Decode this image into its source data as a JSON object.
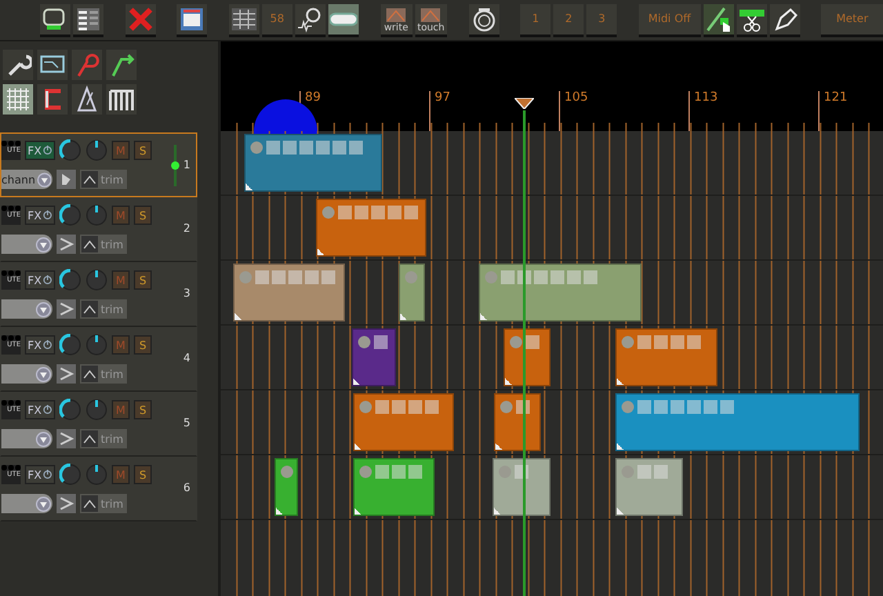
{
  "toolbar": {
    "snap_value": "58",
    "automation": [
      "write",
      "touch"
    ],
    "screensets": [
      "1",
      "2",
      "3"
    ],
    "midi": "Midi Off",
    "meter": "Meter"
  },
  "ruler": {
    "bars": [
      "89",
      "97",
      "105",
      "113",
      "121"
    ]
  },
  "tracks": [
    {
      "number": "1",
      "selected": true,
      "mute_label": "UTE",
      "fx_label": "FX",
      "fx_on": true,
      "mute": "M",
      "solo": "S",
      "input": "chann",
      "trim": "trim",
      "clips": [
        {
          "color": "#2a7a9a"
        }
      ]
    },
    {
      "number": "2",
      "selected": false,
      "mute_label": "UTE",
      "fx_label": "FX",
      "fx_on": false,
      "mute": "M",
      "solo": "S",
      "trim": "trim",
      "clips": [
        {
          "color": "#c8620e"
        }
      ]
    },
    {
      "number": "3",
      "selected": false,
      "mute_label": "UTE",
      "fx_label": "FX",
      "fx_on": false,
      "mute": "M",
      "solo": "S",
      "trim": "trim",
      "clips": [
        {
          "color": "#a88a6a"
        },
        {
          "color": "#8aa070"
        },
        {
          "color": "#8aa070"
        }
      ]
    },
    {
      "number": "4",
      "selected": false,
      "mute_label": "UTE",
      "fx_label": "FX",
      "fx_on": false,
      "mute": "M",
      "solo": "S",
      "trim": "trim",
      "clips": [
        {
          "color": "#5a2a8a"
        },
        {
          "color": "#c8620e"
        },
        {
          "color": "#c8620e"
        }
      ]
    },
    {
      "number": "5",
      "selected": false,
      "mute_label": "UTE",
      "fx_label": "FX",
      "fx_on": false,
      "mute": "M",
      "solo": "S",
      "trim": "trim",
      "clips": [
        {
          "color": "#c8620e"
        },
        {
          "color": "#c8620e"
        },
        {
          "color": "#1a90c0"
        }
      ]
    },
    {
      "number": "6",
      "selected": false,
      "mute_label": "UTE",
      "fx_label": "FX",
      "fx_on": false,
      "mute": "M",
      "solo": "S",
      "trim": "trim",
      "clips": [
        {
          "color": "#38b030"
        },
        {
          "color": "#38b030"
        },
        {
          "color": "#a0aa98"
        },
        {
          "color": "#a0aa98"
        }
      ]
    }
  ]
}
